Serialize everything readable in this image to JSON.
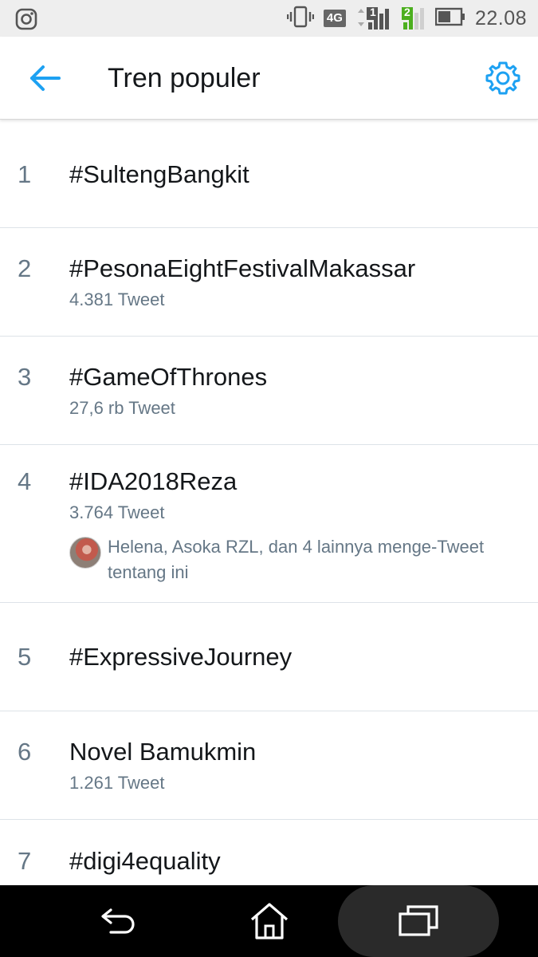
{
  "status_bar": {
    "time": "22.08",
    "network": "4G",
    "sim1_label": "1",
    "sim2_label": "2",
    "icons": [
      "instagram-icon",
      "vibrate-icon",
      "signal-icon",
      "battery-icon"
    ]
  },
  "header": {
    "title": "Tren populer",
    "back_icon": "arrow-left-icon",
    "settings_icon": "gear-icon",
    "accent_color": "#1da1f2"
  },
  "trends": [
    {
      "rank": "1",
      "name": "#SultengBangkit",
      "count": ""
    },
    {
      "rank": "2",
      "name": "#PesonaEightFestivalMakassar",
      "count": "4.381 Tweet"
    },
    {
      "rank": "3",
      "name": "#GameOfThrones",
      "count": "27,6 rb Tweet"
    },
    {
      "rank": "4",
      "name": "#IDA2018Reza",
      "count": "3.764 Tweet",
      "social": "Helena, Asoka RZL, dan 4 lainnya menge-Tweet tentang ini"
    },
    {
      "rank": "5",
      "name": "#ExpressiveJourney",
      "count": ""
    },
    {
      "rank": "6",
      "name": "Novel Bamukmin",
      "count": "1.261 Tweet"
    },
    {
      "rank": "7",
      "name": "#digi4equality",
      "count": ""
    }
  ],
  "nav_bar": {
    "icons": [
      "back-nav-icon",
      "home-icon",
      "recent-apps-icon"
    ]
  }
}
